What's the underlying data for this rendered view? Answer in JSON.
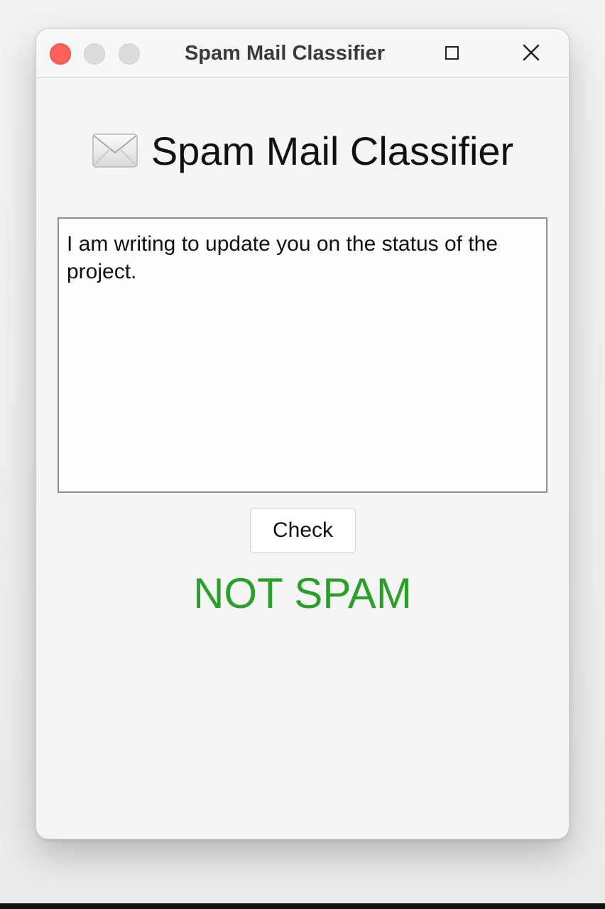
{
  "window": {
    "title": "Spam Mail Classifier"
  },
  "heading": {
    "icon": "envelope-icon",
    "text": "Spam Mail Classifier"
  },
  "message": {
    "value": "I am writing to update you on the status of the project."
  },
  "check_button": {
    "label": "Check"
  },
  "result": {
    "text": "NOT SPAM",
    "color": "#2aa02a"
  },
  "colors": {
    "close_button": "#fe5f57",
    "inactive_button": "#dcdcdc",
    "window_background": "#f5f5f5"
  }
}
